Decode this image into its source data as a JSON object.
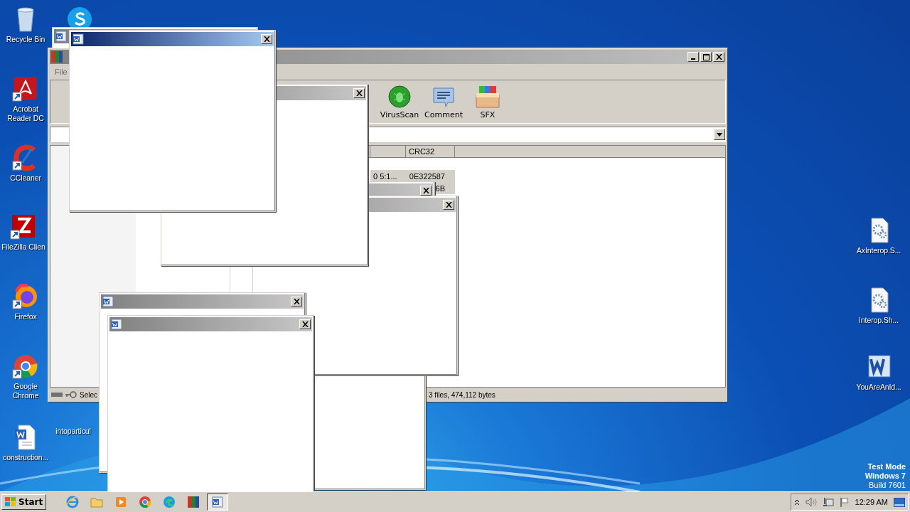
{
  "desktop_icons": [
    {
      "kind": "recycle",
      "label": "Recycle Bin",
      "shortcut": false
    },
    {
      "kind": "skype",
      "shortcut": false
    },
    {
      "kind": "acrobat",
      "label": "Acrobat\nReader DC",
      "shortcut": true
    },
    {
      "kind": "ccleaner",
      "label": "CCleaner",
      "shortcut": true
    },
    {
      "kind": "filezilla",
      "label": "FileZilla Clien",
      "shortcut": true
    },
    {
      "kind": "firefox",
      "label": "Firefox",
      "shortcut": true
    },
    {
      "kind": "chrome",
      "label": "Google\nChrome",
      "shortcut": true
    },
    {
      "kind": "worddoc",
      "label": "construction...",
      "shortcut": false
    },
    {
      "kind": "hidden",
      "label": "intoparticul"
    },
    {
      "kind": "geardoc",
      "label": "AxInterop.S...",
      "shortcut": false
    },
    {
      "kind": "geardoc",
      "label": "Interop.Sh...",
      "shortcut": false
    },
    {
      "kind": "word",
      "label": "YouAreAnId...",
      "shortcut": false
    }
  ],
  "winrar": {
    "menu": [
      "File"
    ],
    "toolbar": [
      {
        "kind": "virusscan",
        "label": "VirusScan"
      },
      {
        "kind": "comment",
        "label": "Comment"
      },
      {
        "kind": "sfx",
        "label": "SFX"
      }
    ],
    "columns": [
      {
        "label": "CRC32"
      }
    ],
    "rows": [
      {
        "column_1": "0 5:1...",
        "crc32": "0E322587",
        "selected": true
      },
      {
        "crc32": "6B",
        "selected": true
      }
    ],
    "status": {
      "selection": "Selec",
      "totals": "3 files, 474,112 bytes"
    }
  },
  "dialogs": [
    {
      "active": false
    },
    {
      "active": false
    },
    {
      "active": false
    },
    {
      "active": false
    },
    {
      "active": true
    },
    {
      "active": false
    },
    {
      "active": false
    }
  ],
  "system_watermark": [
    "Test Mode",
    "Windows 7",
    "Build 7601"
  ],
  "taskbar": {
    "start": "Start",
    "apps": [
      {
        "kind": "ie",
        "pressed": false
      },
      {
        "kind": "explorer",
        "pressed": false
      },
      {
        "kind": "media",
        "pressed": false
      },
      {
        "kind": "chrome",
        "pressed": false
      },
      {
        "kind": "edge",
        "pressed": false
      },
      {
        "kind": "winrar",
        "pressed": false
      },
      {
        "kind": "word",
        "pressed": true
      }
    ],
    "clock": "12:29 AM"
  }
}
